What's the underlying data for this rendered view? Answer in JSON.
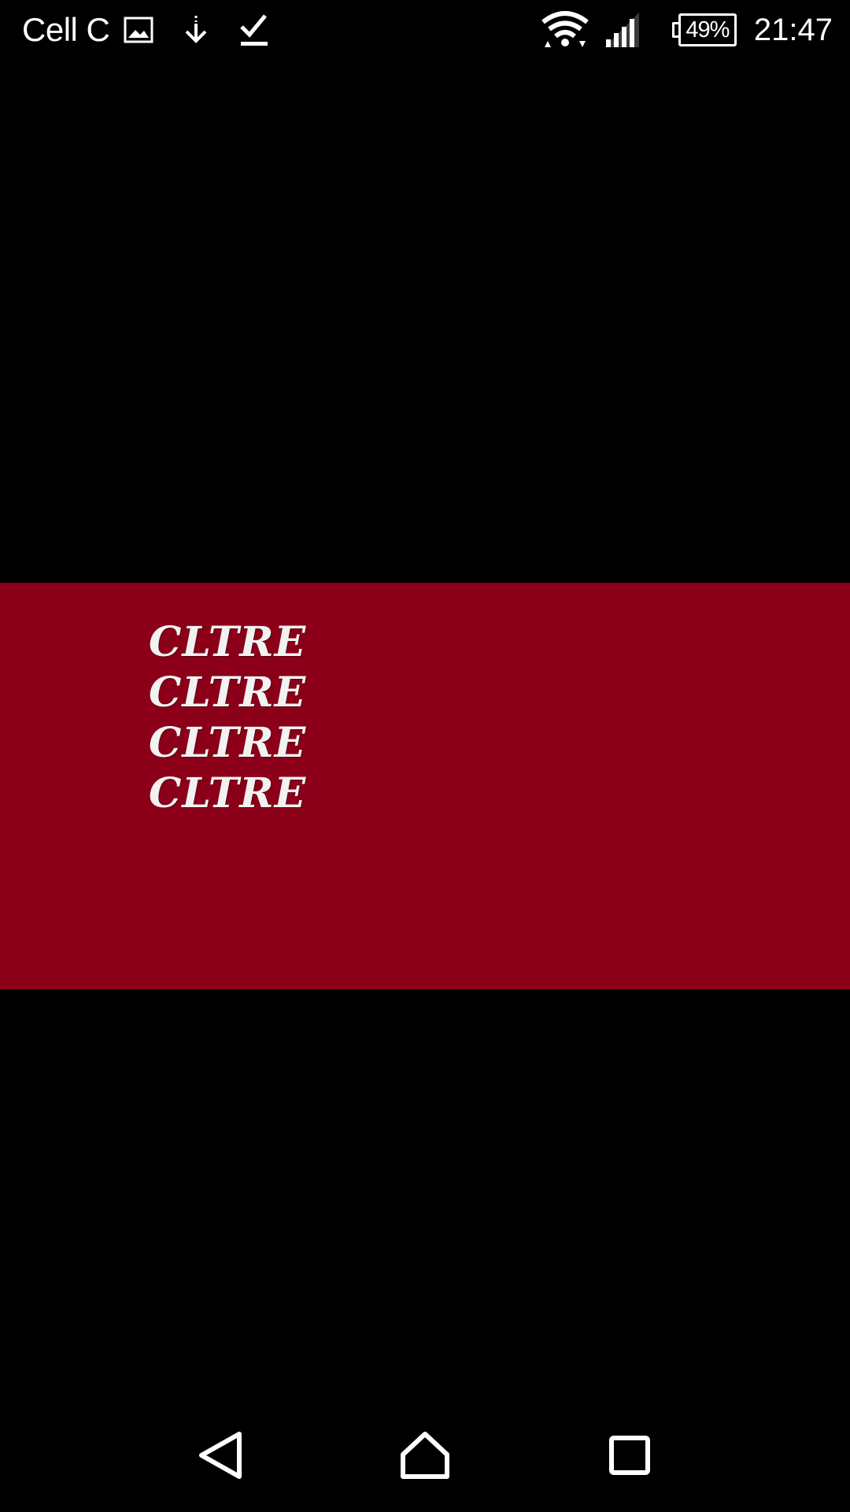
{
  "status_bar": {
    "carrier": "Cell C",
    "left_icons": [
      "image-notification-icon",
      "download-icon",
      "download-complete-icon"
    ],
    "right_icons": [
      "wifi-icon",
      "cell-signal-icon",
      "battery-icon"
    ],
    "battery_level": "49%",
    "time": "21:47"
  },
  "viewer": {
    "background_color": "#8b0018",
    "text_lines": [
      "CLTRE",
      "CLTRE",
      "CLTRE",
      "CLTRE"
    ]
  },
  "nav_bar": {
    "buttons": [
      "back-icon",
      "home-icon",
      "recents-icon"
    ]
  }
}
